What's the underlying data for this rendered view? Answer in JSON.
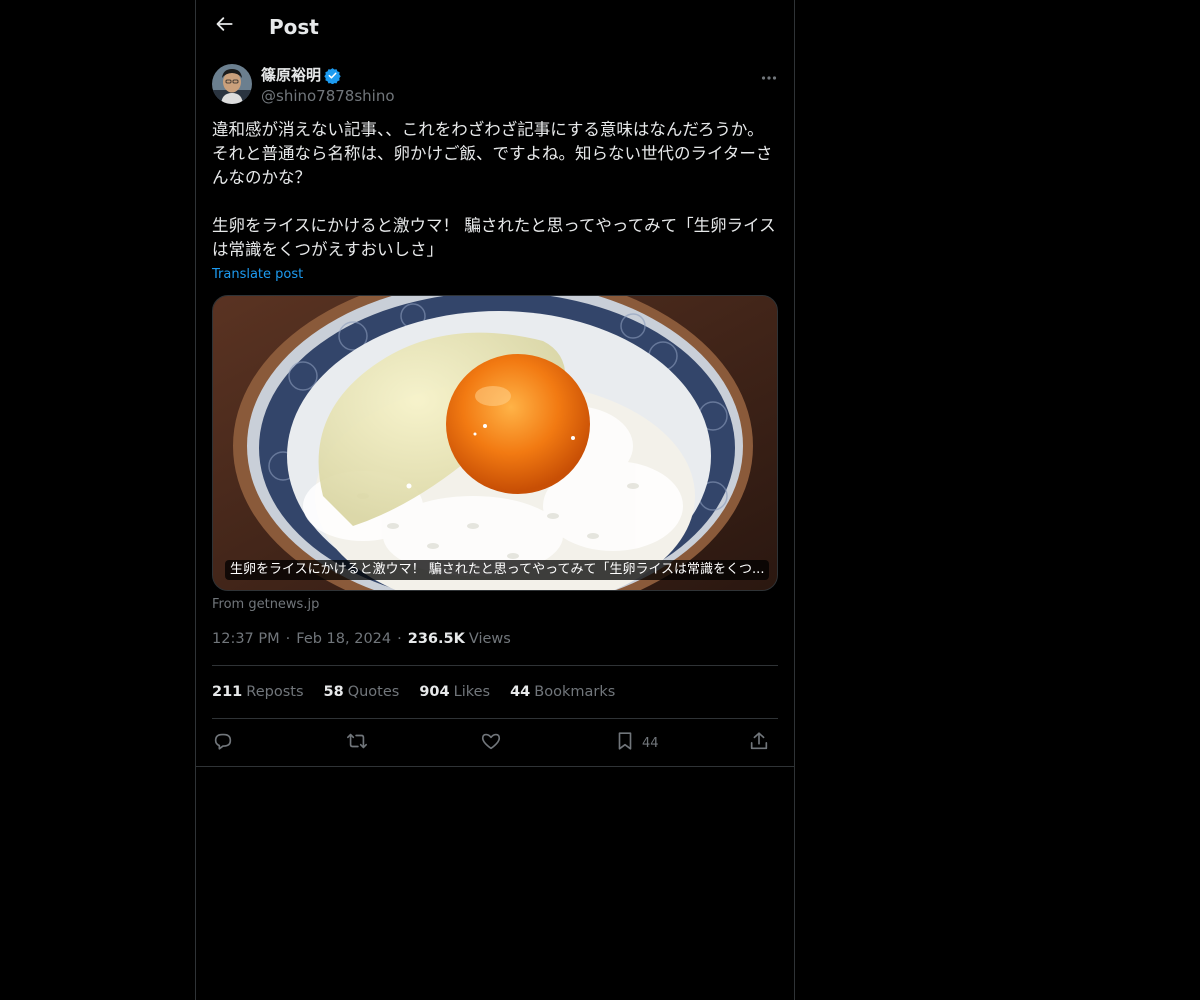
{
  "header": {
    "title": "Post",
    "back_icon": "arrow-left-icon"
  },
  "author": {
    "name": "篠原裕明",
    "handle": "@shino7878shino",
    "verified": true,
    "verified_color": "#1d9bf0"
  },
  "tweet": {
    "text": "違和感が消えない記事、、これをわざわざ記事にする意味はなんだろうか。それと普通なら名称は、卵かけご飯、ですよね。知らない世代のライターさんなのかな？\n\n生卵をライスにかけると激ウマ！ 騙されたと思ってやってみて「生卵ライスは常識をくつがえすおいしさ」",
    "translate_label": "Translate post"
  },
  "card": {
    "caption": "生卵をライスにかけると激ウマ！ 騙されたと思ってやってみて「生卵ライスは常識をくつ...",
    "source": "From getnews.jp"
  },
  "meta": {
    "time": "12:37 PM",
    "date": "Feb 18, 2024",
    "views_count": "236.5K",
    "views_label": "Views"
  },
  "stats": [
    {
      "count": "211",
      "label": "Reposts"
    },
    {
      "count": "58",
      "label": "Quotes"
    },
    {
      "count": "904",
      "label": "Likes"
    },
    {
      "count": "44",
      "label": "Bookmarks"
    }
  ],
  "actions": {
    "reply_icon": "reply-icon",
    "repost_icon": "repost-icon",
    "like_icon": "heart-icon",
    "bookmark_icon": "bookmark-icon",
    "bookmark_count": "44",
    "share_icon": "share-icon"
  },
  "colors": {
    "background": "#000000",
    "text": "#e7e9ea",
    "muted": "#71767b",
    "accent": "#1d9bf0",
    "border": "#2f3336"
  }
}
